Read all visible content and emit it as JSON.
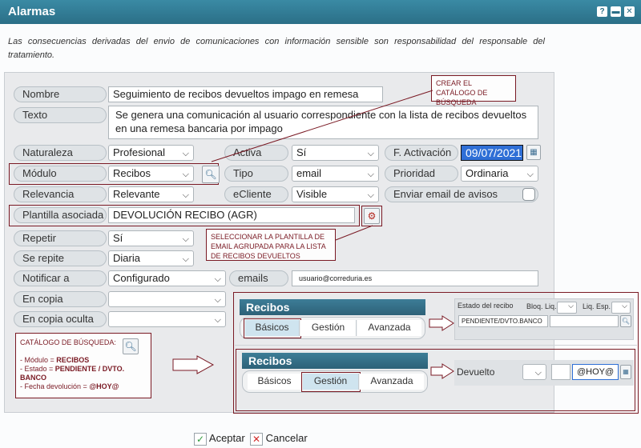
{
  "window": {
    "title": "Alarmas",
    "btn_help": "?",
    "btn_min": "▬",
    "btn_close": "✕"
  },
  "notice": "Las consecuencias derivadas del envio de comunicaciones con información sensible son responsabilidad del responsable del tratamiento.",
  "form": {
    "nombre": {
      "label": "Nombre",
      "value": "Seguimiento de recibos devueltos impago en remesa"
    },
    "texto": {
      "label": "Texto",
      "value": "Se genera una comunicación al usuario correspondiente con la lista de recibos devueltos en una remesa bancaria por impago"
    },
    "naturaleza": {
      "label": "Naturaleza",
      "value": "Profesional"
    },
    "activa": {
      "label": "Activa",
      "value": "Sí"
    },
    "f_activacion": {
      "label": "F. Activación",
      "value": "09/07/2021"
    },
    "modulo": {
      "label": "Módulo",
      "value": "Recibos"
    },
    "tipo": {
      "label": "Tipo",
      "value": "email"
    },
    "prioridad": {
      "label": "Prioridad",
      "value": "Ordinaria"
    },
    "relevancia": {
      "label": "Relevancia",
      "value": "Relevante"
    },
    "ecliente": {
      "label": "eCliente",
      "value": "Visible"
    },
    "enviar_email": {
      "label": "Enviar email de avisos"
    },
    "plantilla": {
      "label": "Plantilla asociada",
      "value": "DEVOLUCIÓN RECIBO (AGR)"
    },
    "repetir": {
      "label": "Repetir",
      "value": "Sí"
    },
    "se_repite": {
      "label": "Se repite",
      "value": "Diaria"
    },
    "notificar": {
      "label": "Notificar a",
      "value": "Configurado"
    },
    "emails": {
      "label": "emails",
      "value": "usuario@correduria.es"
    },
    "en_copia": {
      "label": "En copia",
      "value": ""
    },
    "en_copia_oculta": {
      "label": "En copia oculta",
      "value": ""
    }
  },
  "annotations": {
    "crear_catalogo": "CREAR EL CATÁLOGO DE BÚSQUEDA",
    "seleccionar_plantilla": "SELECCIONAR LA PLANTILLA DE EMAIL AGRUPADA PARA LA LISTA DE RECIBOS DEVUELTOS",
    "catalogo_title": "CATÁLOGO DE BÚSQUEDA:",
    "catalogo_line1_pre": "- Módulo = ",
    "catalogo_line1_val": "RECIBOS",
    "catalogo_line2_pre": "- Estado = ",
    "catalogo_line2_val": "PENDIENTE / DVTO. BANCO",
    "catalogo_line3_pre": "- Fecha devolución = ",
    "catalogo_line3_val": "@HOY@"
  },
  "recibos_panel_1": {
    "header": "Recibos",
    "tabs": [
      "Básicos",
      "Gestión",
      "Avanzada"
    ],
    "active_tab": "Básicos",
    "estado_label": "Estado del recibo",
    "bloq_label": "Bloq. Liq.",
    "liq_label": "Liq. Esp.",
    "estado_value": "PENDIENTE/DVTO.BANCO"
  },
  "recibos_panel_2": {
    "header": "Recibos",
    "tabs": [
      "Básicos",
      "Gestión",
      "Avanzada"
    ],
    "active_tab": "Gestión",
    "devuelto_label": "Devuelto",
    "devuelto_value": "@HOY@"
  },
  "footer": {
    "accept": "Aceptar",
    "cancel": "Cancelar"
  },
  "colors": {
    "accent": "#2b6f87",
    "annotation": "#7a1a24",
    "date_highlight": "#2f6fd6"
  }
}
